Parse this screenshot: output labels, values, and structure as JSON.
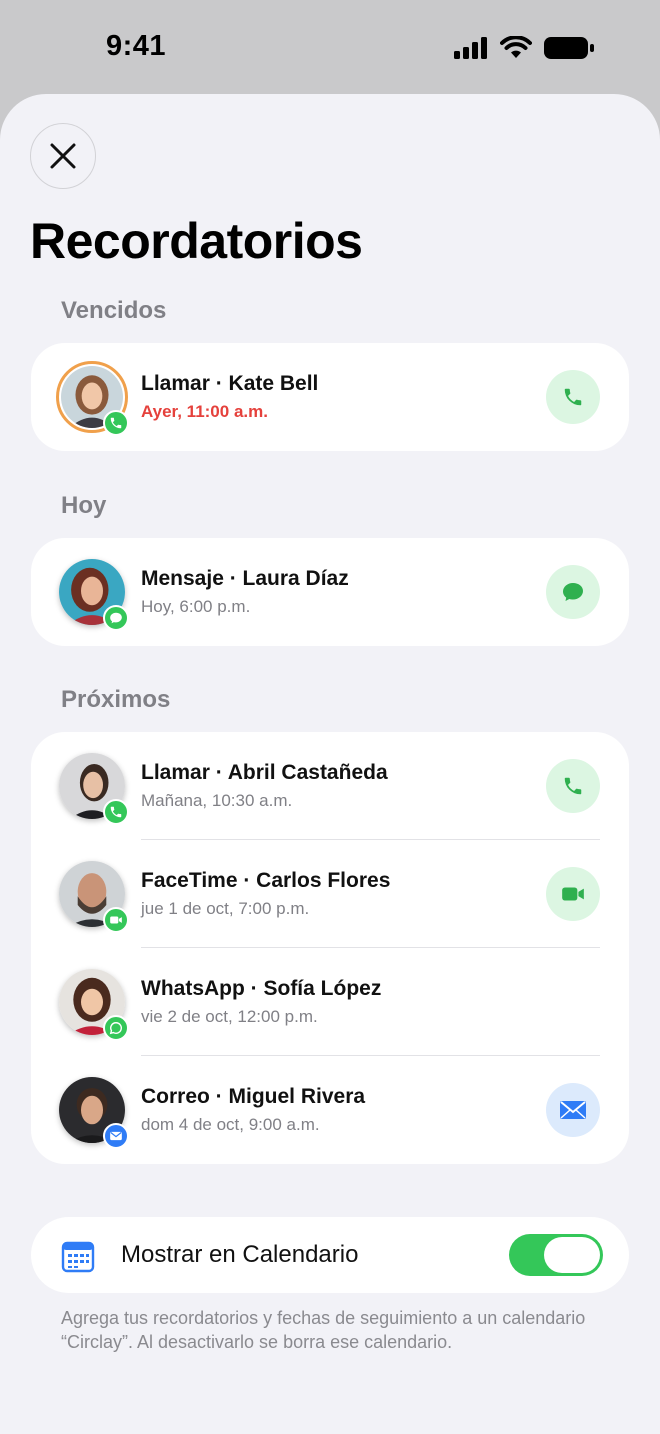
{
  "status_bar": {
    "time": "9:41"
  },
  "header": {
    "title": "Recordatorios"
  },
  "sections": [
    {
      "label": "Vencidos",
      "items": [
        {
          "title": "Llamar · Kate Bell",
          "subtitle": "Ayer, 11:00 a.m.",
          "badge_icon": "phone-icon",
          "action_icon": "phone-icon",
          "overdue": true
        }
      ]
    },
    {
      "label": "Hoy",
      "items": [
        {
          "title": "Mensaje · Laura Díaz",
          "subtitle": "Hoy, 6:00 p.m.",
          "badge_icon": "message-bubble-icon",
          "action_icon": "message-bubble-icon"
        }
      ]
    },
    {
      "label": "Próximos",
      "items": [
        {
          "title": "Llamar · Abril Castañeda",
          "subtitle": "Mañana, 10:30 a.m.",
          "badge_icon": "phone-icon",
          "action_icon": "phone-icon"
        },
        {
          "title": "FaceTime · Carlos Flores",
          "subtitle": "jue 1 de oct, 7:00 p.m.",
          "badge_icon": "video-camera-icon",
          "action_icon": "video-camera-icon"
        },
        {
          "title": "WhatsApp · Sofía López",
          "subtitle": "vie 2 de oct, 12:00 p.m.",
          "badge_icon": "whatsapp-icon",
          "action_icon": ""
        },
        {
          "title": "Correo · Miguel Rivera",
          "subtitle": "dom 4 de oct, 9:00 a.m.",
          "badge_icon": "envelope-icon",
          "action_icon": "envelope-icon"
        }
      ]
    }
  ],
  "calendar_setting": {
    "label": "Mostrar en Calendario",
    "enabled": true,
    "footnote": "Agrega tus recordatorios y fechas de seguimiento a un calendario “Circlay”. Al desactivarlo se borra ese calendario."
  },
  "colors": {
    "accent_green": "#34c759",
    "overdue_red": "#e5413c",
    "mail_blue": "#2f7cf6",
    "ring_orange": "#f0a04b"
  }
}
